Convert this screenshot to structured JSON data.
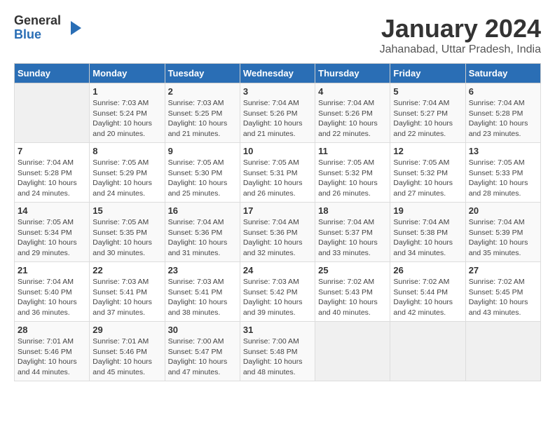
{
  "header": {
    "logo_general": "General",
    "logo_blue": "Blue",
    "month_title": "January 2024",
    "location": "Jahanabad, Uttar Pradesh, India"
  },
  "days_of_week": [
    "Sunday",
    "Monday",
    "Tuesday",
    "Wednesday",
    "Thursday",
    "Friday",
    "Saturday"
  ],
  "weeks": [
    [
      {
        "num": "",
        "sunrise": "",
        "sunset": "",
        "daylight": ""
      },
      {
        "num": "1",
        "sunrise": "Sunrise: 7:03 AM",
        "sunset": "Sunset: 5:24 PM",
        "daylight": "Daylight: 10 hours and 20 minutes."
      },
      {
        "num": "2",
        "sunrise": "Sunrise: 7:03 AM",
        "sunset": "Sunset: 5:25 PM",
        "daylight": "Daylight: 10 hours and 21 minutes."
      },
      {
        "num": "3",
        "sunrise": "Sunrise: 7:04 AM",
        "sunset": "Sunset: 5:26 PM",
        "daylight": "Daylight: 10 hours and 21 minutes."
      },
      {
        "num": "4",
        "sunrise": "Sunrise: 7:04 AM",
        "sunset": "Sunset: 5:26 PM",
        "daylight": "Daylight: 10 hours and 22 minutes."
      },
      {
        "num": "5",
        "sunrise": "Sunrise: 7:04 AM",
        "sunset": "Sunset: 5:27 PM",
        "daylight": "Daylight: 10 hours and 22 minutes."
      },
      {
        "num": "6",
        "sunrise": "Sunrise: 7:04 AM",
        "sunset": "Sunset: 5:28 PM",
        "daylight": "Daylight: 10 hours and 23 minutes."
      }
    ],
    [
      {
        "num": "7",
        "sunrise": "Sunrise: 7:04 AM",
        "sunset": "Sunset: 5:28 PM",
        "daylight": "Daylight: 10 hours and 24 minutes."
      },
      {
        "num": "8",
        "sunrise": "Sunrise: 7:05 AM",
        "sunset": "Sunset: 5:29 PM",
        "daylight": "Daylight: 10 hours and 24 minutes."
      },
      {
        "num": "9",
        "sunrise": "Sunrise: 7:05 AM",
        "sunset": "Sunset: 5:30 PM",
        "daylight": "Daylight: 10 hours and 25 minutes."
      },
      {
        "num": "10",
        "sunrise": "Sunrise: 7:05 AM",
        "sunset": "Sunset: 5:31 PM",
        "daylight": "Daylight: 10 hours and 26 minutes."
      },
      {
        "num": "11",
        "sunrise": "Sunrise: 7:05 AM",
        "sunset": "Sunset: 5:32 PM",
        "daylight": "Daylight: 10 hours and 26 minutes."
      },
      {
        "num": "12",
        "sunrise": "Sunrise: 7:05 AM",
        "sunset": "Sunset: 5:32 PM",
        "daylight": "Daylight: 10 hours and 27 minutes."
      },
      {
        "num": "13",
        "sunrise": "Sunrise: 7:05 AM",
        "sunset": "Sunset: 5:33 PM",
        "daylight": "Daylight: 10 hours and 28 minutes."
      }
    ],
    [
      {
        "num": "14",
        "sunrise": "Sunrise: 7:05 AM",
        "sunset": "Sunset: 5:34 PM",
        "daylight": "Daylight: 10 hours and 29 minutes."
      },
      {
        "num": "15",
        "sunrise": "Sunrise: 7:05 AM",
        "sunset": "Sunset: 5:35 PM",
        "daylight": "Daylight: 10 hours and 30 minutes."
      },
      {
        "num": "16",
        "sunrise": "Sunrise: 7:04 AM",
        "sunset": "Sunset: 5:36 PM",
        "daylight": "Daylight: 10 hours and 31 minutes."
      },
      {
        "num": "17",
        "sunrise": "Sunrise: 7:04 AM",
        "sunset": "Sunset: 5:36 PM",
        "daylight": "Daylight: 10 hours and 32 minutes."
      },
      {
        "num": "18",
        "sunrise": "Sunrise: 7:04 AM",
        "sunset": "Sunset: 5:37 PM",
        "daylight": "Daylight: 10 hours and 33 minutes."
      },
      {
        "num": "19",
        "sunrise": "Sunrise: 7:04 AM",
        "sunset": "Sunset: 5:38 PM",
        "daylight": "Daylight: 10 hours and 34 minutes."
      },
      {
        "num": "20",
        "sunrise": "Sunrise: 7:04 AM",
        "sunset": "Sunset: 5:39 PM",
        "daylight": "Daylight: 10 hours and 35 minutes."
      }
    ],
    [
      {
        "num": "21",
        "sunrise": "Sunrise: 7:04 AM",
        "sunset": "Sunset: 5:40 PM",
        "daylight": "Daylight: 10 hours and 36 minutes."
      },
      {
        "num": "22",
        "sunrise": "Sunrise: 7:03 AM",
        "sunset": "Sunset: 5:41 PM",
        "daylight": "Daylight: 10 hours and 37 minutes."
      },
      {
        "num": "23",
        "sunrise": "Sunrise: 7:03 AM",
        "sunset": "Sunset: 5:41 PM",
        "daylight": "Daylight: 10 hours and 38 minutes."
      },
      {
        "num": "24",
        "sunrise": "Sunrise: 7:03 AM",
        "sunset": "Sunset: 5:42 PM",
        "daylight": "Daylight: 10 hours and 39 minutes."
      },
      {
        "num": "25",
        "sunrise": "Sunrise: 7:02 AM",
        "sunset": "Sunset: 5:43 PM",
        "daylight": "Daylight: 10 hours and 40 minutes."
      },
      {
        "num": "26",
        "sunrise": "Sunrise: 7:02 AM",
        "sunset": "Sunset: 5:44 PM",
        "daylight": "Daylight: 10 hours and 42 minutes."
      },
      {
        "num": "27",
        "sunrise": "Sunrise: 7:02 AM",
        "sunset": "Sunset: 5:45 PM",
        "daylight": "Daylight: 10 hours and 43 minutes."
      }
    ],
    [
      {
        "num": "28",
        "sunrise": "Sunrise: 7:01 AM",
        "sunset": "Sunset: 5:46 PM",
        "daylight": "Daylight: 10 hours and 44 minutes."
      },
      {
        "num": "29",
        "sunrise": "Sunrise: 7:01 AM",
        "sunset": "Sunset: 5:46 PM",
        "daylight": "Daylight: 10 hours and 45 minutes."
      },
      {
        "num": "30",
        "sunrise": "Sunrise: 7:00 AM",
        "sunset": "Sunset: 5:47 PM",
        "daylight": "Daylight: 10 hours and 47 minutes."
      },
      {
        "num": "31",
        "sunrise": "Sunrise: 7:00 AM",
        "sunset": "Sunset: 5:48 PM",
        "daylight": "Daylight: 10 hours and 48 minutes."
      },
      {
        "num": "",
        "sunrise": "",
        "sunset": "",
        "daylight": ""
      },
      {
        "num": "",
        "sunrise": "",
        "sunset": "",
        "daylight": ""
      },
      {
        "num": "",
        "sunrise": "",
        "sunset": "",
        "daylight": ""
      }
    ]
  ]
}
